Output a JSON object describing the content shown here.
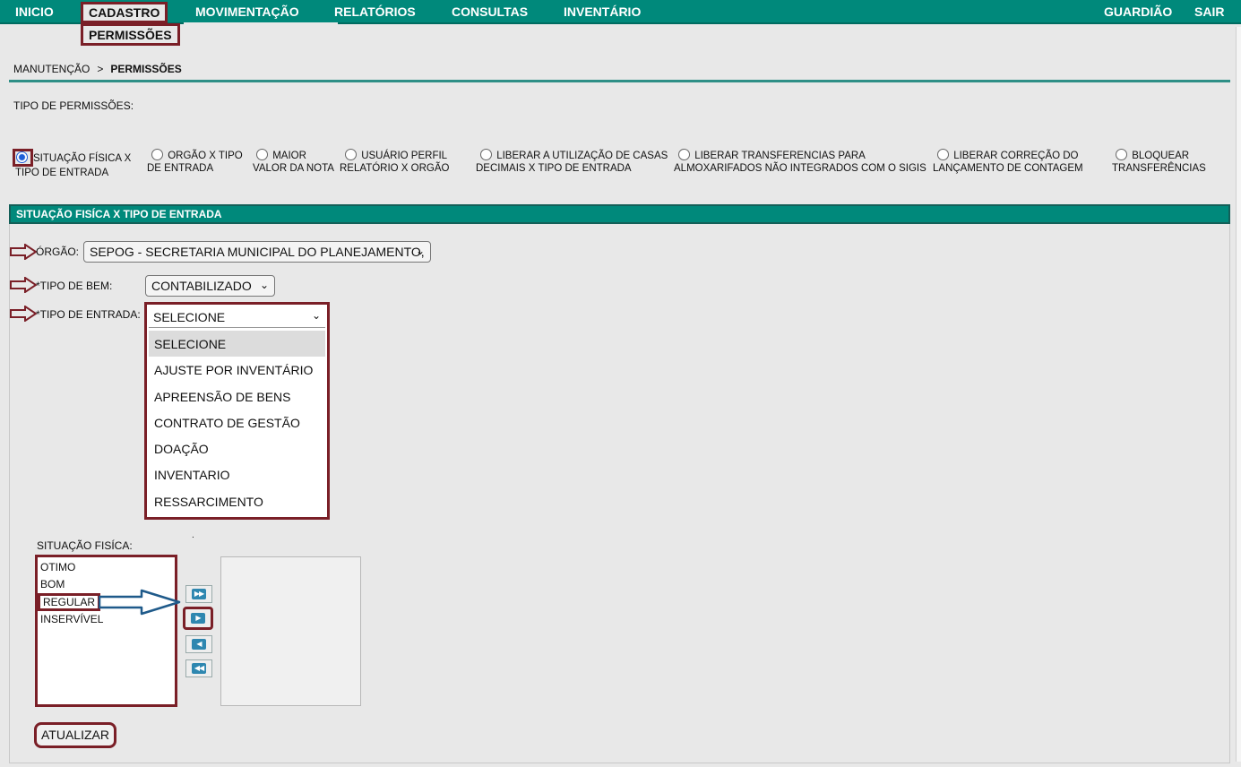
{
  "nav": {
    "items": [
      "INICIO",
      "CADASTRO",
      "MOVIMENTAÇÃO",
      "RELATÓRIOS",
      "CONSULTAS",
      "INVENTÁRIO"
    ],
    "right_items": [
      "GUARDIÃO",
      "SAIR"
    ],
    "active": "CADASTRO",
    "submenu": "PERMISSÕES"
  },
  "breadcrumb": {
    "parent": "MANUTENÇÃO",
    "separator": ">",
    "current": "PERMISSÕES"
  },
  "permission_type_label": "TIPO DE PERMISSÕES:",
  "radio_options": [
    {
      "line1": "SITUAÇÃO FÍSICA X",
      "line2": "TIPO DE ENTRADA",
      "checked": true
    },
    {
      "line1": "ORGÃO X TIPO",
      "line2": "DE ENTRADA",
      "checked": false
    },
    {
      "line1": "MAIOR",
      "line2": "VALOR DA NOTA",
      "checked": false
    },
    {
      "line1": "USUÁRIO PERFIL",
      "line2": "RELATÓRIO X ORGÃO",
      "checked": false
    },
    {
      "line1": "LIBERAR A UTILIZAÇÃO DE CASAS",
      "line2": "DECIMAIS X TIPO DE ENTRADA",
      "checked": false
    },
    {
      "line1": "LIBERAR TRANSFERENCIAS PARA",
      "line2": "ALMOXARIFADOS NÃO INTEGRADOS COM O SIGIS",
      "checked": false
    },
    {
      "line1": "LIBERAR CORREÇÃO DO",
      "line2": "LANÇAMENTO DE CONTAGEM",
      "checked": false
    },
    {
      "line1": "BLOQUEAR",
      "line2": "TRANSFERÊNCIAS",
      "checked": false
    }
  ],
  "section": {
    "title": "SITUAÇÃO FISÍCA X TIPO DE ENTRADA",
    "orgao": {
      "label": "ÓRGÃO:",
      "value": "SEPOG - SECRETARIA MUNICIPAL DO PLANEJAMENTO,"
    },
    "tipo_bem": {
      "label": "*TIPO DE BEM:",
      "value": "CONTABILIZADO"
    },
    "tipo_entrada": {
      "label": "*TIPO DE ENTRADA:",
      "value": "SELECIONE",
      "options": [
        "SELECIONE",
        "AJUSTE POR INVENTÁRIO",
        "APREENSÃO DE BENS",
        "CONTRATO DE GESTÃO",
        "DOAÇÃO",
        "INVENTARIO",
        "RESSARCIMENTO"
      ],
      "selected_index": 0
    },
    "situacao": {
      "label": "SITUAÇÃO FISÍCA:",
      "available": [
        "OTIMO",
        "BOM",
        "REGULAR",
        "INSERVÍVEL"
      ],
      "highlighted": "REGULAR",
      "selected": [],
      "dot": "."
    },
    "update_label": "ATUALIZAR"
  },
  "colors": {
    "header_teal": "#00897b",
    "highlight_border": "#7a1f27",
    "arrow_blue": "#1f5a8a"
  },
  "icons": {
    "move_all_right": "double-chevron-right-icon",
    "move_right": "chevron-right-icon",
    "move_left": "chevron-left-icon",
    "move_all_left": "double-chevron-left-icon"
  }
}
